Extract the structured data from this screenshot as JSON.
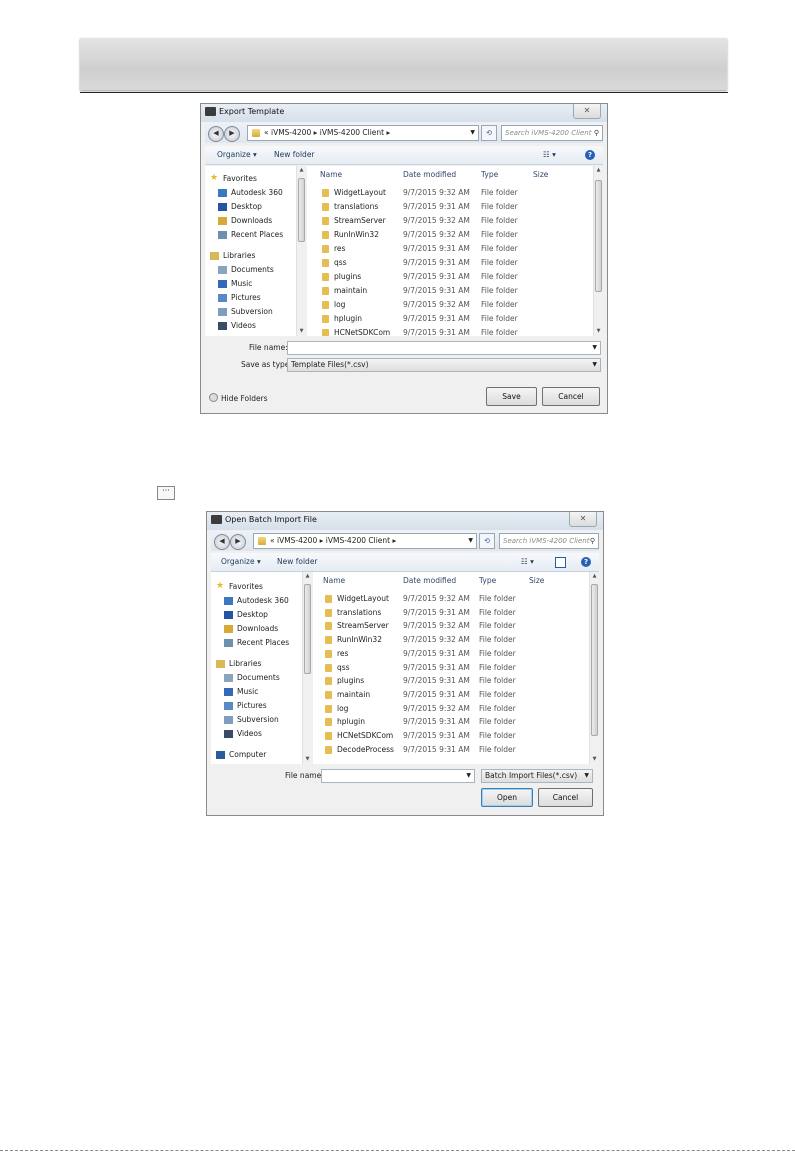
{
  "dialog1": {
    "title": "Export Template",
    "close": "✕",
    "path": [
      "iVMS-4200",
      "iVMS-4200 Client"
    ],
    "path_prefix": "«",
    "search_placeholder": "Search iVMS-4200 Client",
    "toolbar": {
      "organize": "Organize ▾",
      "new_folder": "New folder",
      "view": "☷ ▾",
      "help": "?"
    },
    "nav": [
      {
        "label": "Favorites",
        "icon": "star-icon",
        "group": true
      },
      {
        "label": "Autodesk 360",
        "icon": "cloud-icon"
      },
      {
        "label": "Desktop",
        "icon": "desktop-icon"
      },
      {
        "label": "Downloads",
        "icon": "downloads-icon"
      },
      {
        "label": "Recent Places",
        "icon": "recent-places-icon"
      },
      {
        "label": "Libraries",
        "icon": "libraries-icon",
        "group": true
      },
      {
        "label": "Documents",
        "icon": "documents-icon"
      },
      {
        "label": "Music",
        "icon": "music-icon"
      },
      {
        "label": "Pictures",
        "icon": "pictures-icon"
      },
      {
        "label": "Subversion",
        "icon": "subversion-icon"
      },
      {
        "label": "Videos",
        "icon": "videos-icon"
      }
    ],
    "columns": {
      "name": "Name",
      "date": "Date modified",
      "type": "Type",
      "size": "Size"
    },
    "files": [
      {
        "name": "WidgetLayout",
        "date": "9/7/2015 9:32 AM",
        "type": "File folder"
      },
      {
        "name": "translations",
        "date": "9/7/2015 9:31 AM",
        "type": "File folder"
      },
      {
        "name": "StreamServer",
        "date": "9/7/2015 9:32 AM",
        "type": "File folder"
      },
      {
        "name": "RunInWin32",
        "date": "9/7/2015 9:32 AM",
        "type": "File folder"
      },
      {
        "name": "res",
        "date": "9/7/2015 9:31 AM",
        "type": "File folder"
      },
      {
        "name": "qss",
        "date": "9/7/2015 9:31 AM",
        "type": "File folder"
      },
      {
        "name": "plugins",
        "date": "9/7/2015 9:31 AM",
        "type": "File folder"
      },
      {
        "name": "maintain",
        "date": "9/7/2015 9:31 AM",
        "type": "File folder"
      },
      {
        "name": "log",
        "date": "9/7/2015 9:32 AM",
        "type": "File folder"
      },
      {
        "name": "hplugin",
        "date": "9/7/2015 9:31 AM",
        "type": "File folder"
      },
      {
        "name": "HCNetSDKCom",
        "date": "9/7/2015 9:31 AM",
        "type": "File folder"
      }
    ],
    "file_name_label": "File name:",
    "file_name_value": "",
    "save_type_label": "Save as type:",
    "save_type_value": "Template Files(*.csv)",
    "hide_folders": "Hide Folders",
    "save_button": "Save",
    "cancel_button": "Cancel"
  },
  "browse_button": "···",
  "dialog2": {
    "title": "Open Batch Import File",
    "close": "✕",
    "path": [
      "iVMS-4200",
      "iVMS-4200 Client"
    ],
    "path_prefix": "«",
    "search_placeholder": "Search iVMS-4200 Client",
    "toolbar": {
      "organize": "Organize ▾",
      "new_folder": "New folder",
      "view": "☷ ▾",
      "help": "?"
    },
    "nav": [
      {
        "label": "Favorites",
        "icon": "star-icon",
        "group": true
      },
      {
        "label": "Autodesk 360",
        "icon": "cloud-icon"
      },
      {
        "label": "Desktop",
        "icon": "desktop-icon"
      },
      {
        "label": "Downloads",
        "icon": "downloads-icon"
      },
      {
        "label": "Recent Places",
        "icon": "recent-places-icon"
      },
      {
        "label": "Libraries",
        "icon": "libraries-icon",
        "group": true
      },
      {
        "label": "Documents",
        "icon": "documents-icon"
      },
      {
        "label": "Music",
        "icon": "music-icon"
      },
      {
        "label": "Pictures",
        "icon": "pictures-icon"
      },
      {
        "label": "Subversion",
        "icon": "subversion-icon"
      },
      {
        "label": "Videos",
        "icon": "videos-icon"
      },
      {
        "label": "Computer",
        "icon": "computer-icon",
        "group": true
      }
    ],
    "columns": {
      "name": "Name",
      "date": "Date modified",
      "type": "Type",
      "size": "Size"
    },
    "files": [
      {
        "name": "WidgetLayout",
        "date": "9/7/2015 9:32 AM",
        "type": "File folder"
      },
      {
        "name": "translations",
        "date": "9/7/2015 9:31 AM",
        "type": "File folder"
      },
      {
        "name": "StreamServer",
        "date": "9/7/2015 9:32 AM",
        "type": "File folder"
      },
      {
        "name": "RunInWin32",
        "date": "9/7/2015 9:32 AM",
        "type": "File folder"
      },
      {
        "name": "res",
        "date": "9/7/2015 9:31 AM",
        "type": "File folder"
      },
      {
        "name": "qss",
        "date": "9/7/2015 9:31 AM",
        "type": "File folder"
      },
      {
        "name": "plugins",
        "date": "9/7/2015 9:31 AM",
        "type": "File folder"
      },
      {
        "name": "maintain",
        "date": "9/7/2015 9:31 AM",
        "type": "File folder"
      },
      {
        "name": "log",
        "date": "9/7/2015 9:32 AM",
        "type": "File folder"
      },
      {
        "name": "hplugin",
        "date": "9/7/2015 9:31 AM",
        "type": "File folder"
      },
      {
        "name": "HCNetSDKCom",
        "date": "9/7/2015 9:31 AM",
        "type": "File folder"
      },
      {
        "name": "DecodeProcess",
        "date": "9/7/2015 9:31 AM",
        "type": "File folder"
      }
    ],
    "file_name_label": "File name:",
    "file_name_value": "",
    "file_type_value": "Batch Import Files(*.csv)",
    "open_button": "Open",
    "cancel_button": "Cancel"
  },
  "colors": {
    "folder": "#e6bd52",
    "accent": "#2660b4",
    "nav_text": "#1e3957"
  }
}
